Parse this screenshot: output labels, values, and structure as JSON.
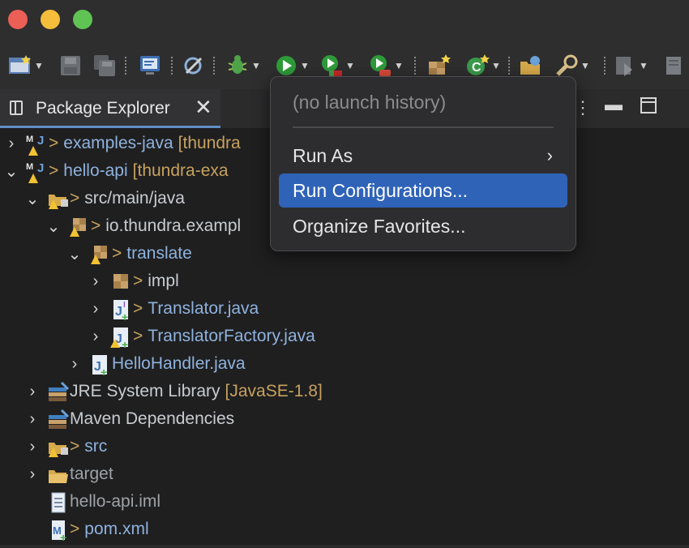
{
  "window": {
    "traffic_lights": [
      "close",
      "minimize",
      "zoom"
    ],
    "colors": {
      "close": "#ec5f57",
      "minimize": "#f4bd3b",
      "zoom": "#5fc453"
    }
  },
  "toolbar": {
    "icons": [
      "new-icon",
      "save-icon",
      "save-all-icon",
      "terminal-icon",
      "skip-breakpoints-icon",
      "debug-icon",
      "run-icon",
      "coverage-icon",
      "external-tools-icon",
      "new-java-package-icon",
      "new-java-class-icon",
      "open-type-icon",
      "search-icon",
      "annotation-nav-icon",
      "last-edit-icon"
    ]
  },
  "view": {
    "tab_title": "Package Explorer",
    "close_glyph": "✕",
    "accent": "#5f8ec6"
  },
  "tree": {
    "rows": [
      {
        "chevron": ">",
        "prefix": ">",
        "name": "examples-java",
        "deco": "[thundra",
        "style": "blue"
      },
      {
        "chevron": "v",
        "prefix": ">",
        "name": "hello-api",
        "deco": "[thundra-exa",
        "style": "blue"
      },
      {
        "chevron": "v",
        "prefix": ">",
        "name": "src/main/java",
        "deco": "",
        "style": "normal"
      },
      {
        "chevron": "v",
        "prefix": ">",
        "name": "io.thundra.exampl",
        "deco": "",
        "style": "normal"
      },
      {
        "chevron": "v",
        "prefix": ">",
        "name": "translate",
        "deco": "",
        "style": "blue"
      },
      {
        "chevron": ">",
        "prefix": ">",
        "name": "impl",
        "deco": "",
        "style": "normal"
      },
      {
        "chevron": ">",
        "prefix": ">",
        "name": "Translator.java",
        "deco": "",
        "style": "blue"
      },
      {
        "chevron": ">",
        "prefix": ">",
        "name": "TranslatorFactory.java",
        "deco": "",
        "style": "blue"
      },
      {
        "chevron": ">",
        "prefix": "",
        "name": "HelloHandler.java",
        "deco": "",
        "style": "blue"
      },
      {
        "chevron": ">",
        "prefix": "",
        "name": "JRE System Library",
        "deco": "[JavaSE-1.8]",
        "style": "normal"
      },
      {
        "chevron": ">",
        "prefix": "",
        "name": "Maven Dependencies",
        "deco": "",
        "style": "normal"
      },
      {
        "chevron": ">",
        "prefix": ">",
        "name": "src",
        "deco": "",
        "style": "blue"
      },
      {
        "chevron": ">",
        "prefix": "",
        "name": "target",
        "deco": "",
        "style": "dim"
      },
      {
        "chevron": "",
        "prefix": "",
        "name": "hello-api.iml",
        "deco": "",
        "style": "dim"
      },
      {
        "chevron": "",
        "prefix": ">",
        "name": "pom.xml",
        "deco": "",
        "style": "blue"
      }
    ]
  },
  "menu": {
    "header": "(no launch history)",
    "items": [
      {
        "label": "Run As",
        "submenu": true,
        "selected": false
      },
      {
        "label": "Run Configurations...",
        "submenu": false,
        "selected": true
      },
      {
        "label": "Organize Favorites...",
        "submenu": false,
        "selected": false
      }
    ],
    "submenu_glyph": "›",
    "selected_color": "#2f63b8"
  }
}
